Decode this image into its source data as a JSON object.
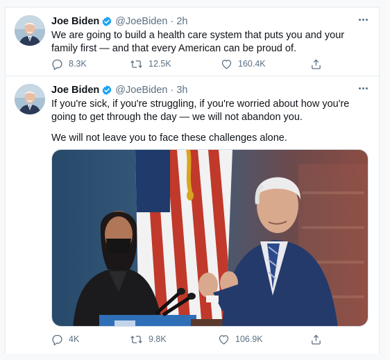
{
  "tweets": [
    {
      "name": "Joe Biden",
      "handle": "@JoeBiden",
      "separator": "·",
      "time": "2h",
      "text": "We are going to build a health care system that puts you and your family first — and that every American can be proud of.",
      "replies": "8.3K",
      "retweets": "12.5K",
      "likes": "160.4K"
    },
    {
      "name": "Joe Biden",
      "handle": "@JoeBiden",
      "separator": "·",
      "time": "3h",
      "text_a": "If you're sick, if you're struggling, if you're worried about how you're going to get through the day — we will not abandon you.",
      "text_b": "We will not leave you to face these challenges alone.",
      "replies": "4K",
      "retweets": "9.8K",
      "likes": "106.9K",
      "media_icon": "photo-of-speakers-at-podium"
    }
  ],
  "colors": {
    "text": "#0f1419",
    "secondary": "#5b7083",
    "verified": "#1da1f2",
    "border": "#e6ecf0",
    "background": "#f7f9fa"
  }
}
